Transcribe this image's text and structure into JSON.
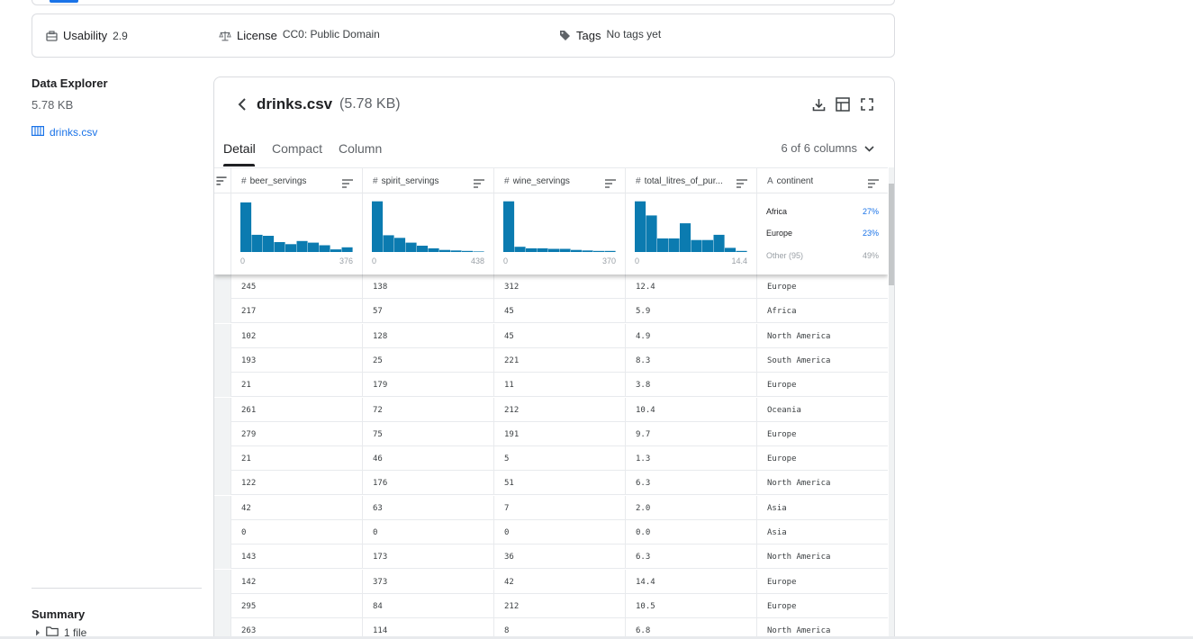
{
  "meta": {
    "usability_label": "Usability",
    "usability_value": "2.9",
    "license_label": "License",
    "license_value": "CC0: Public Domain",
    "tags_label": "Tags",
    "tags_value": "No tags yet"
  },
  "explorer": {
    "title": "Data Explorer",
    "size": "5.78 KB",
    "file_name": "drinks.csv"
  },
  "summary": {
    "title": "Summary",
    "files": "1 file"
  },
  "viewer": {
    "file_title": "drinks.csv",
    "file_size": "(5.78 KB)",
    "tabs": [
      "Detail",
      "Compact",
      "Column"
    ],
    "active_tab": "Detail",
    "column_count": "6 of 6 columns"
  },
  "columns": [
    {
      "type": "#",
      "name": "beer_servings",
      "min": "0",
      "max": "376",
      "hist": [
        0.95,
        0.33,
        0.31,
        0.19,
        0.15,
        0.21,
        0.18,
        0.13,
        0.05,
        0.09
      ]
    },
    {
      "type": "#",
      "name": "spirit_servings",
      "min": "0",
      "max": "438",
      "hist": [
        0.97,
        0.32,
        0.27,
        0.18,
        0.12,
        0.07,
        0.04,
        0.03,
        0.02,
        0.01
      ]
    },
    {
      "type": "#",
      "name": "wine_servings",
      "min": "0",
      "max": "370",
      "hist": [
        0.97,
        0.1,
        0.07,
        0.07,
        0.06,
        0.06,
        0.04,
        0.03,
        0.02,
        0.02
      ]
    },
    {
      "type": "#",
      "name": "total_litres_of_pur...",
      "min": "0",
      "max": "14.4",
      "hist": [
        0.97,
        0.7,
        0.26,
        0.26,
        0.55,
        0.23,
        0.23,
        0.33,
        0.08,
        0.02
      ]
    },
    {
      "type": "A",
      "name": "continent",
      "categories": [
        {
          "label": "Africa",
          "pct": "27%"
        },
        {
          "label": "Europe",
          "pct": "23%"
        },
        {
          "label": "Other (95)",
          "pct": "49%"
        }
      ]
    }
  ],
  "rows": [
    [
      "245",
      "138",
      "312",
      "12.4",
      "Europe"
    ],
    [
      "217",
      "57",
      "45",
      "5.9",
      "Africa"
    ],
    [
      "102",
      "128",
      "45",
      "4.9",
      "North America"
    ],
    [
      "193",
      "25",
      "221",
      "8.3",
      "South America"
    ],
    [
      "21",
      "179",
      "11",
      "3.8",
      "Europe"
    ],
    [
      "261",
      "72",
      "212",
      "10.4",
      "Oceania"
    ],
    [
      "279",
      "75",
      "191",
      "9.7",
      "Europe"
    ],
    [
      "21",
      "46",
      "5",
      "1.3",
      "Europe"
    ],
    [
      "122",
      "176",
      "51",
      "6.3",
      "North America"
    ],
    [
      "42",
      "63",
      "7",
      "2.0",
      "Asia"
    ],
    [
      "0",
      "0",
      "0",
      "0.0",
      "Asia"
    ],
    [
      "143",
      "173",
      "36",
      "6.3",
      "North America"
    ],
    [
      "142",
      "373",
      "42",
      "14.4",
      "Europe"
    ],
    [
      "295",
      "84",
      "212",
      "10.5",
      "Europe"
    ],
    [
      "263",
      "114",
      "8",
      "6.8",
      "North America"
    ]
  ],
  "colors": {
    "accent": "#1a73e8",
    "histogram": "#0b7bb0"
  },
  "icons": {
    "usability": "usability-icon",
    "license": "scale-icon",
    "tags": "tag-icon",
    "table": "table-icon",
    "back": "chevron-left-icon",
    "download": "download-icon",
    "grid": "grid-icon",
    "fullscreen": "fullscreen-icon",
    "sort": "sort-icon",
    "dropdown": "chevron-down-icon",
    "folder": "folder-icon",
    "expand": "caret-right-icon"
  }
}
